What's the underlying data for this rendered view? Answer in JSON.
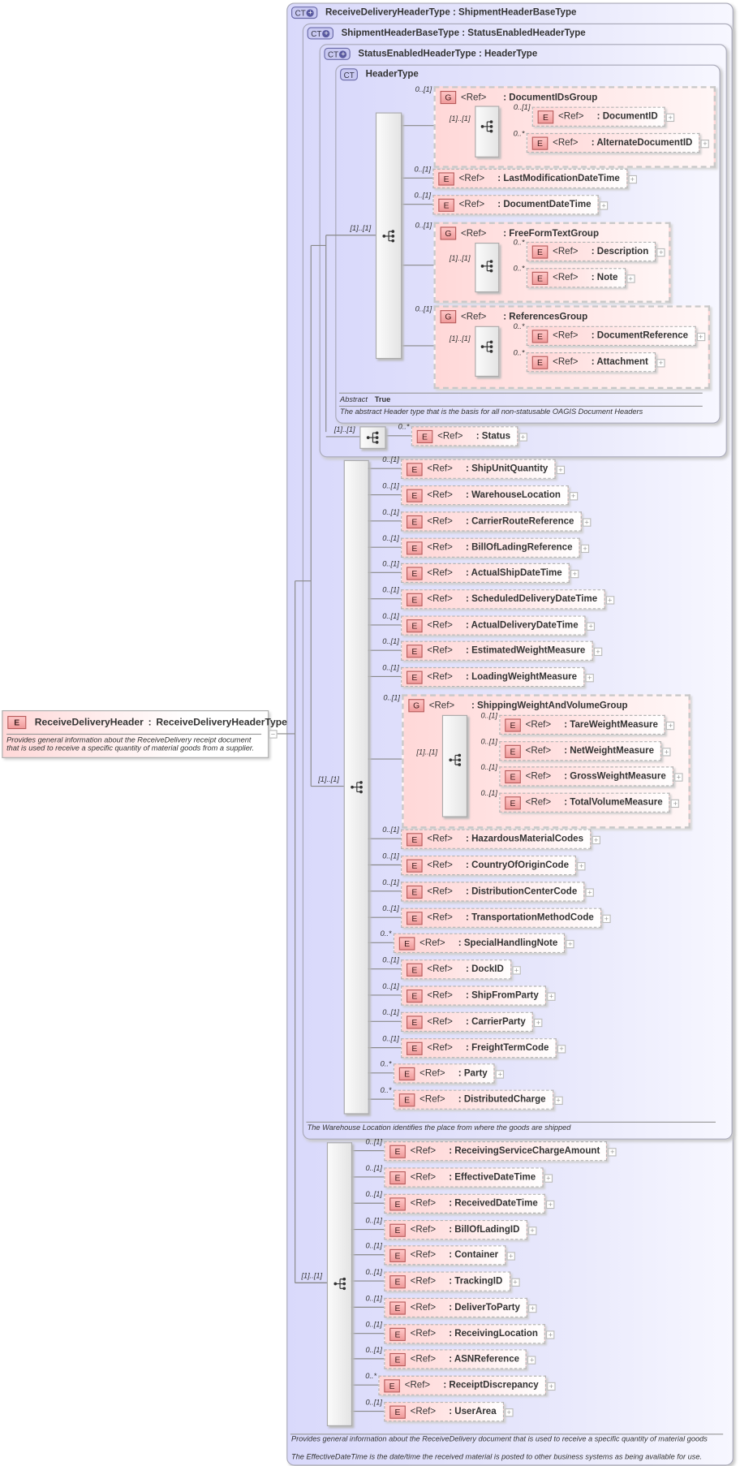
{
  "badges": {
    "element": "E",
    "group": "G",
    "complex_type": "CT"
  },
  "ref_label": "<Ref>",
  "root": {
    "name": "ReceiveDeliveryHeader",
    "separator": ":",
    "type": "ReceiveDeliveryHeaderType",
    "description_lines": [
      "Provides general information about the ReceiveDelivery receipt document",
      "that is used to receive a specific quantity of material goods from a supplier."
    ]
  },
  "complex_types": {
    "receive_delivery": "ReceiveDeliveryHeaderType : ShipmentHeaderBaseType",
    "shipment_base": "ShipmentHeaderBaseType : StatusEnabledHeaderType",
    "status_enabled": "StatusEnabledHeaderType : HeaderType",
    "header": "HeaderType"
  },
  "header_type": {
    "seq_occurs": "[1]..[1]",
    "abstract_label": "Abstract",
    "abstract_value": "True",
    "description": "The abstract Header type that is the basis for all non-statusable OAGIS Document Headers",
    "document_ids_group": {
      "occurs": "0..[1]",
      "name": ": DocumentIDsGroup",
      "seq_occurs": "[1]..[1]",
      "children": [
        {
          "occurs": "0..[1]",
          "name": ": DocumentID"
        },
        {
          "occurs": "0..*",
          "name": ": AlternateDocumentID"
        }
      ]
    },
    "last_modification": {
      "occurs": "0..[1]",
      "name": ": LastModificationDateTime"
    },
    "document_date": {
      "occurs": "0..[1]",
      "name": ": DocumentDateTime"
    },
    "free_form_group": {
      "occurs": "0..[1]",
      "name": ": FreeFormTextGroup",
      "seq_occurs": "[1]..[1]",
      "children": [
        {
          "occurs": "0..*",
          "name": ": Description"
        },
        {
          "occurs": "0..*",
          "name": ": Note"
        }
      ]
    },
    "references_group": {
      "occurs": "0..[1]",
      "name": ": ReferencesGroup",
      "seq_occurs": "[1]..[1]",
      "children": [
        {
          "occurs": "0..*",
          "name": ": DocumentReference"
        },
        {
          "occurs": "0..*",
          "name": ": Attachment"
        }
      ]
    }
  },
  "status_enabled": {
    "seq_occurs": "[1]..[1]",
    "status": {
      "occurs": "0..*",
      "name": ": Status"
    }
  },
  "shipment_base": {
    "seq_occurs": "[1]..[1]",
    "description": "The Warehouse Location identifies the place from where the goods are shipped",
    "items_before": [
      {
        "occurs": "0..[1]",
        "name": ": ShipUnitQuantity"
      },
      {
        "occurs": "0..[1]",
        "name": ": WarehouseLocation"
      },
      {
        "occurs": "0..[1]",
        "name": ": CarrierRouteReference"
      },
      {
        "occurs": "0..[1]",
        "name": ": BillOfLadingReference"
      },
      {
        "occurs": "0..[1]",
        "name": ": ActualShipDateTime"
      },
      {
        "occurs": "0..[1]",
        "name": ": ScheduledDeliveryDateTime"
      },
      {
        "occurs": "0..[1]",
        "name": ": ActualDeliveryDateTime"
      },
      {
        "occurs": "0..[1]",
        "name": ": EstimatedWeightMeasure"
      },
      {
        "occurs": "0..[1]",
        "name": ": LoadingWeightMeasure"
      }
    ],
    "weight_group": {
      "occurs": "0..[1]",
      "name": ": ShippingWeightAndVolumeGroup",
      "seq_occurs": "[1]..[1]",
      "children": [
        {
          "occurs": "0..[1]",
          "name": ": TareWeightMeasure"
        },
        {
          "occurs": "0..[1]",
          "name": ": NetWeightMeasure"
        },
        {
          "occurs": "0..[1]",
          "name": ": GrossWeightMeasure"
        },
        {
          "occurs": "0..[1]",
          "name": ": TotalVolumeMeasure"
        }
      ]
    },
    "items_after": [
      {
        "occurs": "0..[1]",
        "name": ": HazardousMaterialCodes"
      },
      {
        "occurs": "0..[1]",
        "name": ": CountryOfOriginCode"
      },
      {
        "occurs": "0..[1]",
        "name": ": DistributionCenterCode"
      },
      {
        "occurs": "0..[1]",
        "name": ": TransportationMethodCode"
      },
      {
        "occurs": "0..*",
        "name": ": SpecialHandlingNote"
      },
      {
        "occurs": "0..[1]",
        "name": ": DockID"
      },
      {
        "occurs": "0..[1]",
        "name": ": ShipFromParty"
      },
      {
        "occurs": "0..[1]",
        "name": ": CarrierParty"
      },
      {
        "occurs": "0..[1]",
        "name": ": FreightTermCode"
      },
      {
        "occurs": "0..*",
        "name": ": Party"
      },
      {
        "occurs": "0..*",
        "name": ": DistributedCharge"
      }
    ]
  },
  "receive_delivery": {
    "seq_occurs": "[1]..[1]",
    "items": [
      {
        "occurs": "0..[1]",
        "name": ": ReceivingServiceChargeAmount"
      },
      {
        "occurs": "0..[1]",
        "name": ": EffectiveDateTime"
      },
      {
        "occurs": "0..[1]",
        "name": ": ReceivedDateTime"
      },
      {
        "occurs": "0..[1]",
        "name": ": BillOfLadingID"
      },
      {
        "occurs": "0..[1]",
        "name": ": Container"
      },
      {
        "occurs": "0..[1]",
        "name": ": TrackingID"
      },
      {
        "occurs": "0..[1]",
        "name": ": DeliverToParty"
      },
      {
        "occurs": "0..[1]",
        "name": ": ReceivingLocation"
      },
      {
        "occurs": "0..[1]",
        "name": ": ASNReference"
      },
      {
        "occurs": "0..*",
        "name": ": ReceiptDiscrepancy"
      },
      {
        "occurs": "0..[1]",
        "name": ": UserArea"
      }
    ],
    "description_lines": [
      "Provides general information about the ReceiveDelivery document that is used to receive a specific quantity of material goods",
      "The EffectiveDateTime is the date/time the received material is posted to other business systems as being available for use."
    ]
  }
}
